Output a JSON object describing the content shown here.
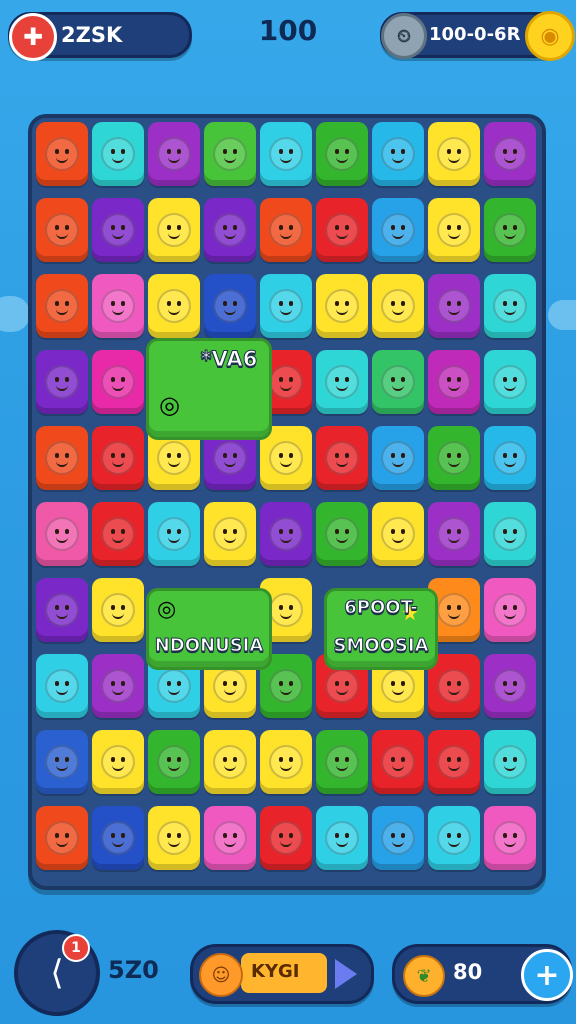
{
  "hud": {
    "score_icon": "plus-cross-icon",
    "score_label": "2ZSK",
    "moves": "100",
    "coins_icon": "timer-icon",
    "coins_label": "100-0-6R",
    "coin_icon": "coin-icon"
  },
  "board": {
    "tiles": [
      {
        "color": "#f04a1c"
      },
      {
        "color": "#2fd6d6"
      },
      {
        "color": "#9c2fc6"
      },
      {
        "color": "#48c43a"
      },
      {
        "color": "#2fd0e6"
      },
      {
        "color": "#34b52e"
      },
      {
        "color": "#27b8ea"
      },
      {
        "color": "#ffe32a"
      },
      {
        "color": "#9c2fc6"
      },
      {
        "color": "#f04a1c"
      },
      {
        "color": "#7a28c8"
      },
      {
        "color": "#ffe32a"
      },
      {
        "color": "#7a28c8"
      },
      {
        "color": "#f04a1c"
      },
      {
        "color": "#e8242a"
      },
      {
        "color": "#27a2e8"
      },
      {
        "color": "#ffe32a"
      },
      {
        "color": "#34b52e"
      },
      {
        "color": "#f04a1c"
      },
      {
        "color": "#f05ac0"
      },
      {
        "color": "#ffe32a"
      },
      {
        "color": "#2450c8"
      },
      {
        "color": "#2fd0e6"
      },
      {
        "color": "#ffe32a"
      },
      {
        "color": "#ffe32a"
      },
      {
        "color": "#9c2fc6"
      },
      {
        "color": "#2fd6d6"
      },
      {
        "color": "#7a28c8"
      },
      {
        "color": "#e82aa8"
      },
      null,
      null,
      {
        "color": "#e8242a"
      },
      {
        "color": "#2fd6d6"
      },
      {
        "color": "#34c468"
      },
      {
        "color": "#c02ab8"
      },
      {
        "color": "#2fd6d6"
      },
      {
        "color": "#f04a1c"
      },
      {
        "color": "#e8242a"
      },
      {
        "color": "#ffe32a"
      },
      {
        "color": "#7a28c8"
      },
      {
        "color": "#ffe32a"
      },
      {
        "color": "#e8242a"
      },
      {
        "color": "#27a2e8"
      },
      {
        "color": "#34b52e"
      },
      {
        "color": "#27b8ea"
      },
      {
        "color": "#f058a8"
      },
      {
        "color": "#e8242a"
      },
      {
        "color": "#2fd0e6"
      },
      {
        "color": "#ffe32a"
      },
      {
        "color": "#7a28c8"
      },
      {
        "color": "#34b52e"
      },
      {
        "color": "#ffe32a"
      },
      {
        "color": "#9c2fc6"
      },
      {
        "color": "#2fd6d6"
      },
      {
        "color": "#7a28c8"
      },
      {
        "color": "#ffe32a"
      },
      null,
      null,
      {
        "color": "#ffe32a"
      },
      null,
      null,
      {
        "color": "#ff8a1c"
      },
      {
        "color": "#f05ac0"
      },
      {
        "color": "#2fd0e6"
      },
      {
        "color": "#9c2fc6"
      },
      {
        "color": "#2fd0e6"
      },
      {
        "color": "#ffe32a"
      },
      {
        "color": "#34b52e"
      },
      {
        "color": "#e8242a"
      },
      {
        "color": "#ffe32a"
      },
      {
        "color": "#e8242a"
      },
      {
        "color": "#9c2fc6"
      },
      {
        "color": "#2a60d0"
      },
      {
        "color": "#ffe32a"
      },
      {
        "color": "#34b52e"
      },
      {
        "color": "#ffe32a"
      },
      {
        "color": "#ffe32a"
      },
      {
        "color": "#34b52e"
      },
      {
        "color": "#e8242a"
      },
      {
        "color": "#e8242a"
      },
      {
        "color": "#2fd6d6"
      },
      {
        "color": "#f04a1c"
      },
      {
        "color": "#2450c8"
      },
      {
        "color": "#ffe32a"
      },
      {
        "color": "#f05ac0"
      },
      {
        "color": "#e8242a"
      },
      {
        "color": "#2fd0e6"
      },
      {
        "color": "#27a2e8"
      },
      {
        "color": "#2fd0e6"
      },
      {
        "color": "#f05ac0"
      }
    ],
    "special_tiles": [
      {
        "label": "*VA6",
        "color": "#48c43a",
        "icon": "swirl-icon"
      },
      {
        "label": "NDONUSIA",
        "color": "#48c43a",
        "icon": "swirl-icon"
      },
      {
        "label": "SMOOSIA",
        "color": "#48c43a",
        "icon": "star-icon"
      },
      {
        "label": "6POOT-",
        "color": "#48c43a",
        "icon": "star-icon"
      }
    ]
  },
  "footer": {
    "share_icon": "share-icon",
    "badge_count": "1",
    "count": "5Z0",
    "booster_icon": "character-icon",
    "booster_label": "KYGI",
    "play_icon": "play-icon",
    "lives_icon": "leaf-icon",
    "lives_value": "80",
    "add_icon": "plus-icon"
  }
}
